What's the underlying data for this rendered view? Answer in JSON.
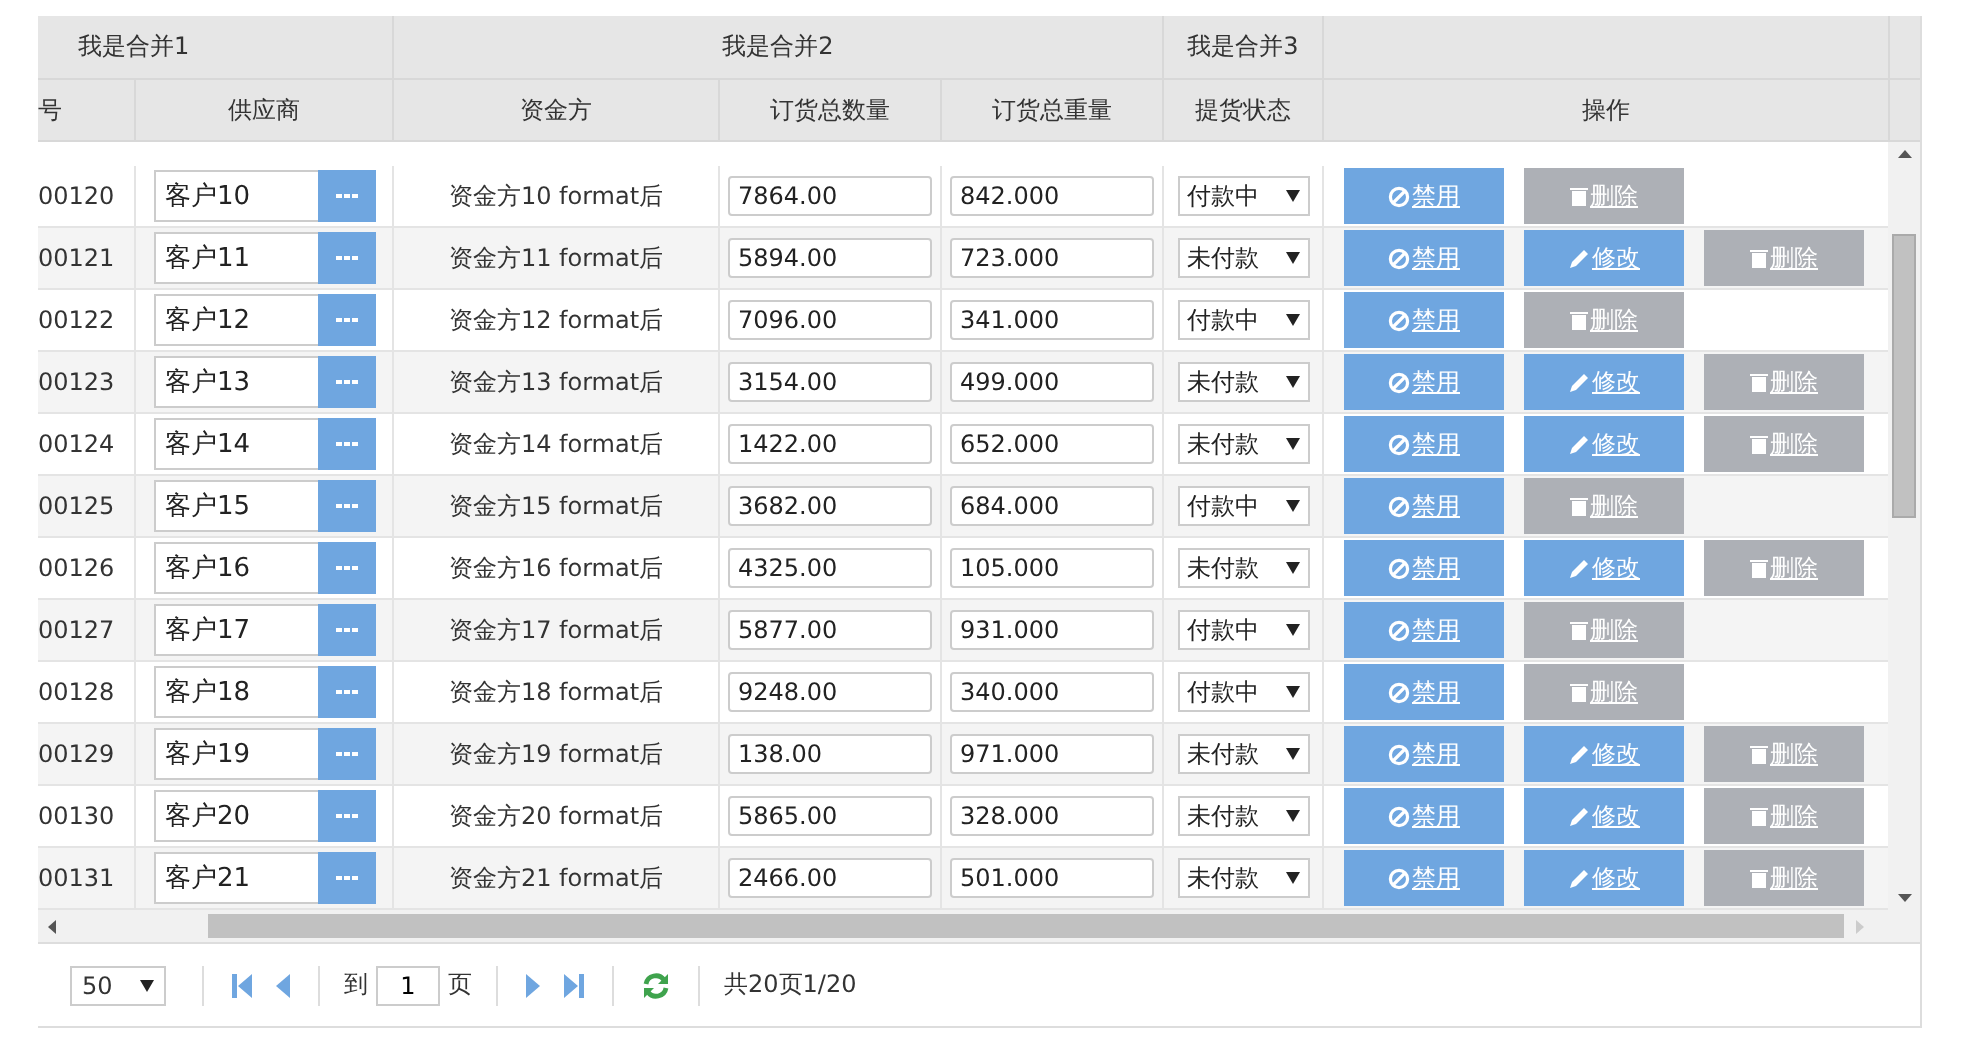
{
  "header_groups": [
    "我是合并1",
    "我是合并2",
    "我是合并3"
  ],
  "columns": [
    "号",
    "供应商",
    "资金方",
    "订货总数量",
    "订货总重量",
    "提货状态",
    "操作"
  ],
  "rows": [
    {
      "code": "00120",
      "supplier": "客户10",
      "funder": "资金方10 format后",
      "quantity": "7864.00",
      "weight": "842.000",
      "status": "付款中",
      "actions": [
        {
          "kind": "disable",
          "label": "禁用"
        },
        {
          "kind": "delete",
          "label": "删除"
        }
      ]
    },
    {
      "code": "00121",
      "supplier": "客户11",
      "funder": "资金方11 format后",
      "quantity": "5894.00",
      "weight": "723.000",
      "status": "未付款",
      "actions": [
        {
          "kind": "disable",
          "label": "禁用"
        },
        {
          "kind": "edit",
          "label": "修改"
        },
        {
          "kind": "delete",
          "label": "删除"
        }
      ]
    },
    {
      "code": "00122",
      "supplier": "客户12",
      "funder": "资金方12 format后",
      "quantity": "7096.00",
      "weight": "341.000",
      "status": "付款中",
      "actions": [
        {
          "kind": "disable",
          "label": "禁用"
        },
        {
          "kind": "delete",
          "label": "删除"
        }
      ]
    },
    {
      "code": "00123",
      "supplier": "客户13",
      "funder": "资金方13 format后",
      "quantity": "3154.00",
      "weight": "499.000",
      "status": "未付款",
      "actions": [
        {
          "kind": "disable",
          "label": "禁用"
        },
        {
          "kind": "edit",
          "label": "修改"
        },
        {
          "kind": "delete",
          "label": "删除"
        }
      ]
    },
    {
      "code": "00124",
      "supplier": "客户14",
      "funder": "资金方14 format后",
      "quantity": "1422.00",
      "weight": "652.000",
      "status": "未付款",
      "actions": [
        {
          "kind": "disable",
          "label": "禁用"
        },
        {
          "kind": "edit",
          "label": "修改"
        },
        {
          "kind": "delete",
          "label": "删除"
        }
      ]
    },
    {
      "code": "00125",
      "supplier": "客户15",
      "funder": "资金方15 format后",
      "quantity": "3682.00",
      "weight": "684.000",
      "status": "付款中",
      "actions": [
        {
          "kind": "disable",
          "label": "禁用"
        },
        {
          "kind": "delete",
          "label": "删除"
        }
      ]
    },
    {
      "code": "00126",
      "supplier": "客户16",
      "funder": "资金方16 format后",
      "quantity": "4325.00",
      "weight": "105.000",
      "status": "未付款",
      "actions": [
        {
          "kind": "disable",
          "label": "禁用"
        },
        {
          "kind": "edit",
          "label": "修改"
        },
        {
          "kind": "delete",
          "label": "删除"
        }
      ]
    },
    {
      "code": "00127",
      "supplier": "客户17",
      "funder": "资金方17 format后",
      "quantity": "5877.00",
      "weight": "931.000",
      "status": "付款中",
      "actions": [
        {
          "kind": "disable",
          "label": "禁用"
        },
        {
          "kind": "delete",
          "label": "删除"
        }
      ]
    },
    {
      "code": "00128",
      "supplier": "客户18",
      "funder": "资金方18 format后",
      "quantity": "9248.00",
      "weight": "340.000",
      "status": "付款中",
      "actions": [
        {
          "kind": "disable",
          "label": "禁用"
        },
        {
          "kind": "delete",
          "label": "删除"
        }
      ]
    },
    {
      "code": "00129",
      "supplier": "客户19",
      "funder": "资金方19 format后",
      "quantity": "138.00",
      "weight": "971.000",
      "status": "未付款",
      "actions": [
        {
          "kind": "disable",
          "label": "禁用"
        },
        {
          "kind": "edit",
          "label": "修改"
        },
        {
          "kind": "delete",
          "label": "删除"
        }
      ]
    },
    {
      "code": "00130",
      "supplier": "客户20",
      "funder": "资金方20 format后",
      "quantity": "5865.00",
      "weight": "328.000",
      "status": "未付款",
      "actions": [
        {
          "kind": "disable",
          "label": "禁用"
        },
        {
          "kind": "edit",
          "label": "修改"
        },
        {
          "kind": "delete",
          "label": "删除"
        }
      ]
    },
    {
      "code": "00131",
      "supplier": "客户21",
      "funder": "资金方21 format后",
      "quantity": "2466.00",
      "weight": "501.000",
      "status": "未付款",
      "actions": [
        {
          "kind": "disable",
          "label": "禁用"
        },
        {
          "kind": "edit",
          "label": "修改"
        },
        {
          "kind": "delete",
          "label": "删除"
        }
      ]
    }
  ],
  "pager": {
    "page_size": "50",
    "goto_label": "到",
    "page": "1",
    "page_unit": "页",
    "summary": "共20页1/20"
  }
}
